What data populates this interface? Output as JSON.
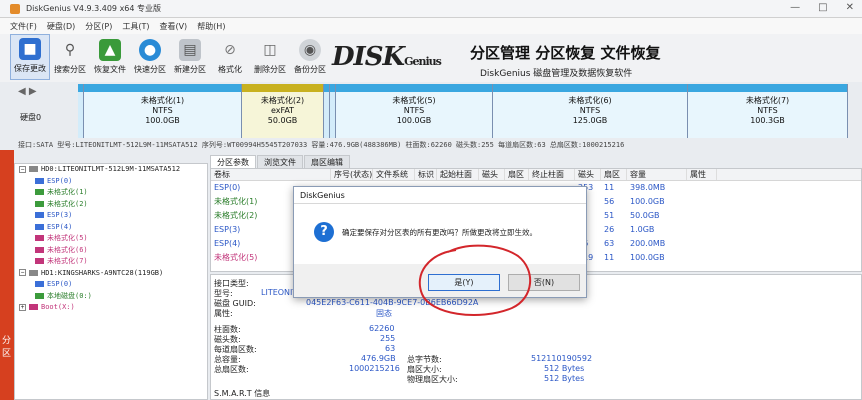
{
  "window": {
    "title": "DiskGenius V4.9.3.409 x64 专业版",
    "controls": [
      "—",
      "□",
      "✕"
    ]
  },
  "menu": [
    "文件(F)",
    "硬盘(D)",
    "分区(P)",
    "工具(T)",
    "查看(V)",
    "帮助(H)"
  ],
  "toolbar": [
    {
      "label": "保存更改",
      "icon": "save-icon",
      "selected": true
    },
    {
      "label": "搜索分区",
      "icon": "search-icon"
    },
    {
      "label": "恢复文件",
      "icon": "recover-files-icon"
    },
    {
      "label": "快速分区",
      "icon": "quick-partition-icon"
    },
    {
      "label": "新建分区",
      "icon": "new-partition-icon"
    },
    {
      "label": "格式化",
      "icon": "format-icon"
    },
    {
      "label": "删除分区",
      "icon": "delete-icon"
    },
    {
      "label": "备份分区",
      "icon": "backup-icon"
    }
  ],
  "banner": {
    "logo_main": "DISK",
    "logo_sub": "Genius",
    "slogan1": "分区管理 分区恢复 文件恢复",
    "slogan2": "DiskGenius 磁盘管理及数据恢复软件"
  },
  "disk_bar": {
    "label": "硬盘0",
    "partitions": [
      {
        "name": "未格式化(1)",
        "fs": "NTFS",
        "size": "100.0GB",
        "kind": "ntfs"
      },
      {
        "name": "未格式化(2)",
        "fs": "exFAT",
        "size": "50.0GB",
        "kind": "exfat"
      },
      {
        "name": "未格式化(5)",
        "fs": "NTFS",
        "size": "100.0GB",
        "kind": "ntfs"
      },
      {
        "name": "未格式化(6)",
        "fs": "NTFS",
        "size": "125.0GB",
        "kind": "ntfs"
      },
      {
        "name": "未格式化(7)",
        "fs": "NTFS",
        "size": "100.3GB",
        "kind": "ntfs"
      }
    ]
  },
  "info_line": "接口:SATA  型号:LITEONITLMT-512L9M-11MSATA512  序列号:WT00994H5545T207033  容量:476.9GB(488386MB)  柱面数:62260  磁头数:255  每道扇区数:63  总扇区数:1000215216",
  "tree": [
    {
      "text": "HD0:LITEONITLMT-512L9M-11MSATA512",
      "indent": 0,
      "color": "",
      "expander": "−"
    },
    {
      "text": "ESP(0)",
      "indent": 1,
      "color": "blue"
    },
    {
      "text": "未格式化(1)",
      "indent": 1,
      "color": "green"
    },
    {
      "text": "未格式化(2)",
      "indent": 1,
      "color": "green"
    },
    {
      "text": "ESP(3)",
      "indent": 1,
      "color": "blue"
    },
    {
      "text": "ESP(4)",
      "indent": 1,
      "color": "blue"
    },
    {
      "text": "未格式化(5)",
      "indent": 1,
      "color": "pink"
    },
    {
      "text": "未格式化(6)",
      "indent": 1,
      "color": "pink"
    },
    {
      "text": "未格式化(7)",
      "indent": 1,
      "color": "pink"
    },
    {
      "text": "HD1:KINGSHARKS-A9NTC28(119GB)",
      "indent": 0,
      "color": "",
      "expander": "−"
    },
    {
      "text": "ESP(0)",
      "indent": 1,
      "color": "blue"
    },
    {
      "text": "本地磁盘(0:)",
      "indent": 1,
      "color": "green"
    },
    {
      "text": "Boot(X:)",
      "indent": 0,
      "color": "pink",
      "expander": "+"
    }
  ],
  "tabs": [
    "分区参数",
    "浏览文件",
    "扇区编辑"
  ],
  "table": {
    "headers": [
      "卷标",
      "序号(状态)",
      "文件系统",
      "标识",
      "起始柱面",
      "磁头",
      "扇区",
      "终止柱面",
      "磁头",
      "扇区",
      "容量",
      "属性"
    ],
    "rows": [
      {
        "name": "ESP(0)",
        "color": "blue",
        "end_head": "253",
        "end_sector": "11",
        "size": "398.0MB"
      },
      {
        "name": "未格式化(1)",
        "color": "green",
        "end_head": "",
        "end_sector": "56",
        "size": "100.0GB"
      },
      {
        "name": "未格式化(2)",
        "color": "green",
        "end_head": "",
        "end_sector": "51",
        "size": "50.0GB"
      },
      {
        "name": "ESP(3)",
        "color": "blue",
        "end_head": "",
        "end_sector": "26",
        "size": "1.0GB"
      },
      {
        "name": "ESP(4)",
        "color": "blue",
        "end_head": "76",
        "end_sector": "63",
        "size": "200.0MB"
      },
      {
        "name": "未格式化(5)",
        "color": "pink",
        "end_head": "119",
        "end_sector": "11",
        "size": "100.0GB"
      }
    ]
  },
  "details": {
    "interface_type_label": "接口类型:",
    "model_label": "型号:",
    "model_value": "LITEONIT",
    "disk_guid_label": "磁盘 GUID:",
    "disk_guid_value": "045E2F63-C611-404B-9CE7-0B6EB66D92A",
    "property_label": "属性:",
    "property_value": "固态",
    "cylinders_label": "柱面数:",
    "cylinders_value": "62260",
    "heads_label": "磁头数:",
    "heads_value": "255",
    "spt_label": "每道扇区数:",
    "spt_value": "63",
    "capacity_label": "总容量:",
    "capacity_value": "476.9GB",
    "total_sectors_label": "总扇区数:",
    "total_sectors_value": "1000215216",
    "total_bytes_label": "总字节数:",
    "total_bytes_value": "512110190592",
    "sector_size_label": "扇区大小:",
    "sector_size_value": "512 Bytes",
    "phys_sector_label": "物理扇区大小:",
    "phys_sector_value": "512 Bytes",
    "smart_label": "S.M.A.R.T 信息"
  },
  "dialog": {
    "title": "DiskGenius",
    "message": "确定要保存对分区表的所有更改吗？所做更改将立即生效。",
    "yes": "是(Y)",
    "no": "否(N)"
  },
  "desktop_label": "分区"
}
